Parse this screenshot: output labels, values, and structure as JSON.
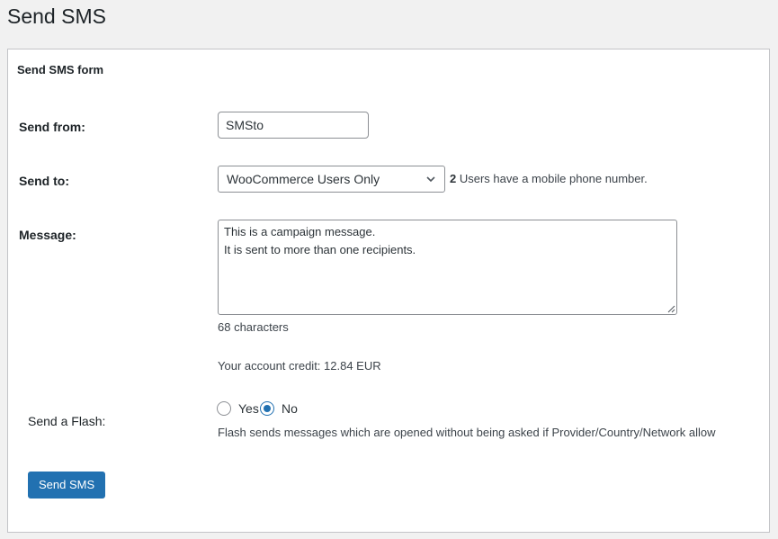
{
  "page": {
    "title": "Send SMS"
  },
  "card": {
    "title": "Send SMS form"
  },
  "send_from": {
    "label": "Send from:",
    "value": "SMSto"
  },
  "send_to": {
    "label": "Send to:",
    "selected": "WooCommerce Users Only",
    "users_count": "2",
    "users_text": "Users have a mobile phone number."
  },
  "message": {
    "label": "Message:",
    "line1": "This is a campaign message.",
    "line2": "It is sent to more than one recipients.",
    "char_count": "68 characters",
    "credit": "Your account credit: 12.84 EUR"
  },
  "flash": {
    "label": "Send a Flash:",
    "option_yes": "Yes",
    "option_no": "No",
    "selected": "No",
    "help": "Flash sends messages which are opened without being asked if Provider/Country/Network allow"
  },
  "actions": {
    "send_label": "Send SMS"
  },
  "colors": {
    "accent": "#2271b1",
    "background": "#f1f1f1",
    "card_border": "#c3c4c7"
  }
}
